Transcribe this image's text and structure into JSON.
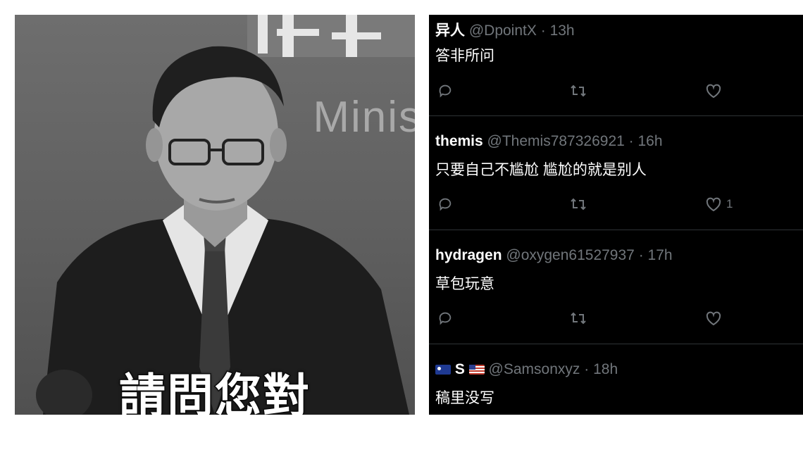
{
  "photo": {
    "background_text": "Minis",
    "caption": "請問您對"
  },
  "tweets": [
    {
      "name": "异人",
      "handle": "@DpointX",
      "time": "13h",
      "text": "答非所问",
      "reply_count": "",
      "retweet_count": "",
      "like_count": ""
    },
    {
      "name": "themis",
      "handle": "@Themis787326921",
      "time": "16h",
      "text": "只要自己不尴尬 尴尬的就是别人",
      "reply_count": "",
      "retweet_count": "",
      "like_count": "1"
    },
    {
      "name": "hydragen",
      "handle": "@oxygen61527937",
      "time": "17h",
      "text": "草包玩意",
      "reply_count": "",
      "retweet_count": "",
      "like_count": ""
    },
    {
      "name": "S",
      "name_prefix_flag": "australia-flag-icon",
      "name_suffix_flag": "us-flag-icon",
      "handle": "@Samsonxyz",
      "time": "18h",
      "text": "稿里没写"
    }
  ],
  "separator": "·",
  "colors": {
    "feed_background": "#000000",
    "muted_text": "#71767b",
    "primary_text": "#ffffff",
    "divider": "#2f3336"
  }
}
